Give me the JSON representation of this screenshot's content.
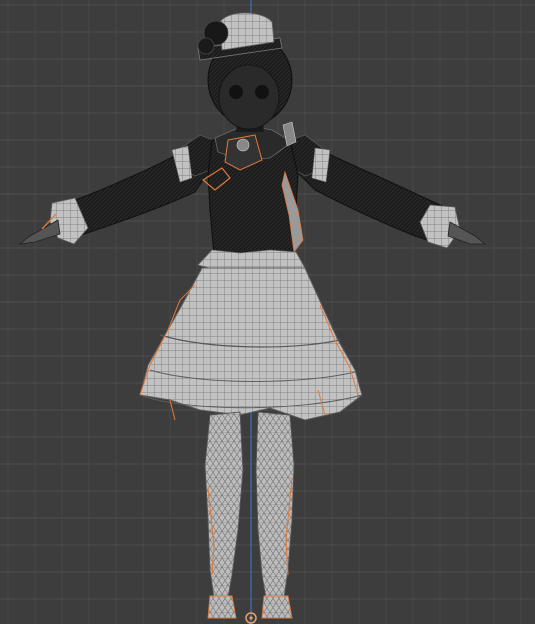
{
  "viewport": {
    "background": "#3d3d3d",
    "grid_minor_color": "#474747",
    "grid_major_color": "#4d4d4d",
    "y_axis_color": "#3f6fb8"
  },
  "model": {
    "dark_fill": "#1c1c1c",
    "dark_wire": "#3a3a3a",
    "light_fill": "#b8b8b8",
    "light_wire": "#7a7a7a",
    "selection_color": "#e07a3a",
    "icon": "mesh-icon"
  },
  "origin": {
    "color": "#e3a46b",
    "icon": "object-origin-icon"
  }
}
